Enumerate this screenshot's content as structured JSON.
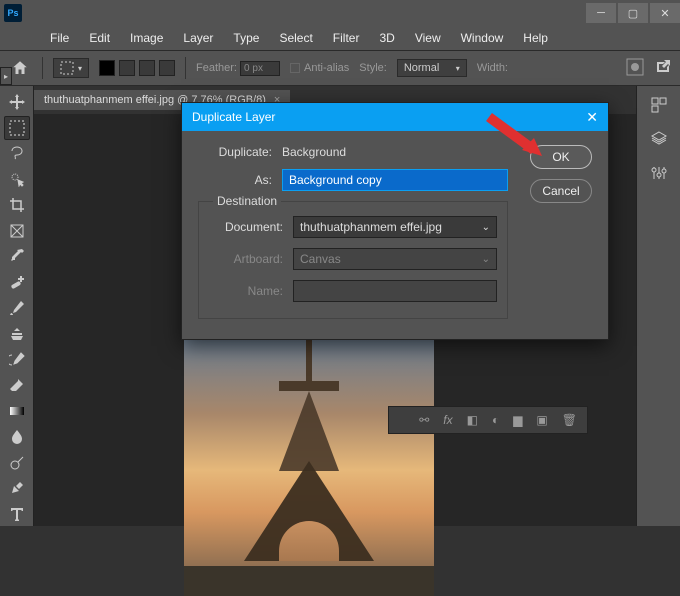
{
  "menu": {
    "items": [
      "File",
      "Edit",
      "Image",
      "Layer",
      "Type",
      "Select",
      "Filter",
      "3D",
      "View",
      "Window",
      "Help"
    ]
  },
  "options": {
    "feather_label": "Feather:",
    "feather_value": "0 px",
    "antialias": "Anti-alias",
    "style_label": "Style:",
    "style_value": "Normal",
    "width_label": "Width:"
  },
  "tab": {
    "label": "thuthuatphanmem effei.jpg @ 7.76% (RGB/8)"
  },
  "dialog": {
    "title": "Duplicate Layer",
    "duplicate_label": "Duplicate:",
    "duplicate_value": "Background",
    "as_label": "As:",
    "as_value": "Background copy",
    "destination_label": "Destination",
    "document_label": "Document:",
    "document_value": "thuthuatphanmem effei.jpg",
    "artboard_label": "Artboard:",
    "artboard_value": "Canvas",
    "name_label": "Name:",
    "name_value": "",
    "ok": "OK",
    "cancel": "Cancel"
  }
}
